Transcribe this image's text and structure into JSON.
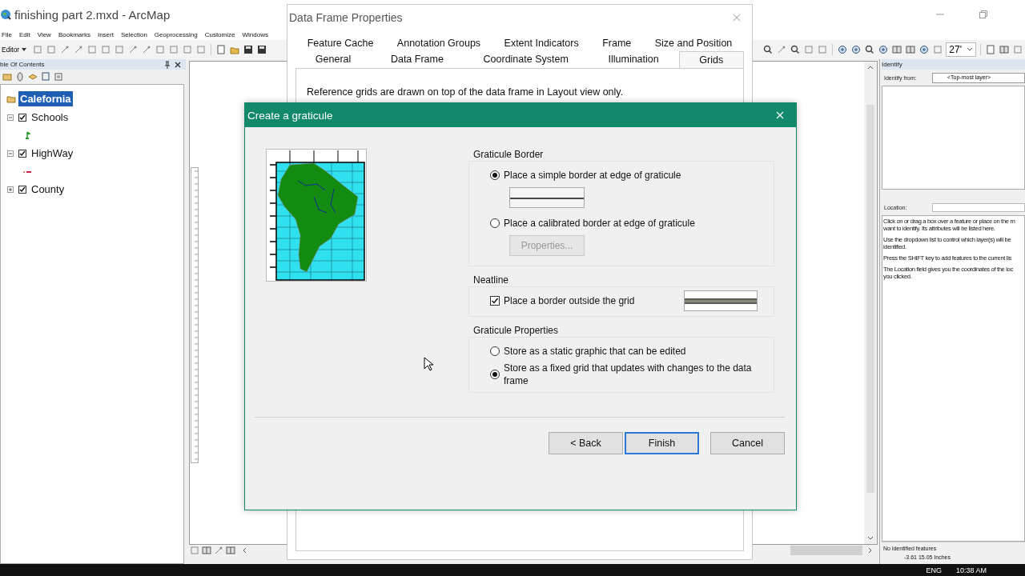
{
  "app": {
    "title": "finishing part 2.mxd - ArcMap",
    "menu": [
      "File",
      "Edit",
      "View",
      "Bookmarks",
      "Insert",
      "Selection",
      "Geoprocessing",
      "Customize",
      "Windows"
    ],
    "editor": "Editor",
    "zoom_scale": "27'"
  },
  "toc": {
    "title": "ble Of Contents",
    "layers": [
      {
        "label": "Calefornia",
        "selected": true,
        "children": [
          {
            "label": "Schools",
            "checked": true,
            "expanded": true,
            "kind": "point"
          },
          {
            "label": "HighWay",
            "checked": true,
            "expanded": true,
            "kind": "line"
          },
          {
            "label": "County",
            "checked": true,
            "expanded": false
          }
        ]
      }
    ]
  },
  "identify": {
    "title": "Identify",
    "from_label": "Identify from:",
    "from_value": "<Top-most layer>",
    "location_label": "Location:",
    "help": [
      [
        "Click on or drag a box over a feature or place on the m",
        "want to identify. Its attributes will be listed here."
      ],
      [
        "Use the dropdown list to control which layer(s) will be",
        "identified."
      ],
      [
        "Press the SHIFT key to add features to the current lis"
      ],
      [
        "The Location field gives you the coordinates of the loc",
        "you clicked."
      ]
    ],
    "status": "No identified features",
    "coordinates": "-3.61  15.05 Inches"
  },
  "data_frame_dialog": {
    "title": "Data Frame Properties",
    "tab_rows": [
      {
        "tabs": [
          {
            "label": "Feature Cache",
            "selected": false
          },
          {
            "label": "Annotation Groups",
            "selected": false
          },
          {
            "label": "Extent Indicators",
            "selected": false
          },
          {
            "label": "Frame",
            "selected": false
          },
          {
            "label": "Size and Position",
            "selected": false
          }
        ]
      },
      {
        "tabs": [
          {
            "label": "General",
            "selected": false
          },
          {
            "label": "Data Frame",
            "selected": false
          },
          {
            "label": "Coordinate System",
            "selected": false
          },
          {
            "label": "Illumination",
            "selected": false
          },
          {
            "label": "Grids",
            "selected": true
          }
        ]
      }
    ],
    "note": "Reference grids are drawn on top of the data frame in Layout view only."
  },
  "graticule": {
    "title": "Create a graticule",
    "sections": [
      {
        "title": "Graticule Border",
        "items": [
          {
            "kind": "radio",
            "label": "Place a simple border at edge of graticule",
            "selected": true
          },
          {
            "kind": "sample"
          },
          {
            "kind": "radio",
            "label": "Place a calibrated border at edge of graticule",
            "selected": false
          },
          {
            "kind": "button",
            "label": "Properties...",
            "disabled": true
          }
        ]
      },
      {
        "title": "Neatline",
        "items": [
          {
            "kind": "checkbox",
            "label": "Place a border outside the grid",
            "checked": true
          },
          {
            "kind": "swatch"
          }
        ]
      },
      {
        "title": "Graticule Properties",
        "items": [
          {
            "kind": "radio",
            "label": "Store as a static graphic that can be edited",
            "selected": false
          },
          {
            "kind": "radio",
            "label": "Store as a fixed grid that updates with changes to the data frame",
            "selected": true
          }
        ]
      }
    ],
    "buttons": [
      {
        "label": "< Back",
        "default": false
      },
      {
        "label": "Finish",
        "default": true
      },
      {
        "label": "Cancel",
        "default": false
      }
    ]
  },
  "taskbar": {
    "language": "ENG",
    "time": "10:38 AM"
  }
}
